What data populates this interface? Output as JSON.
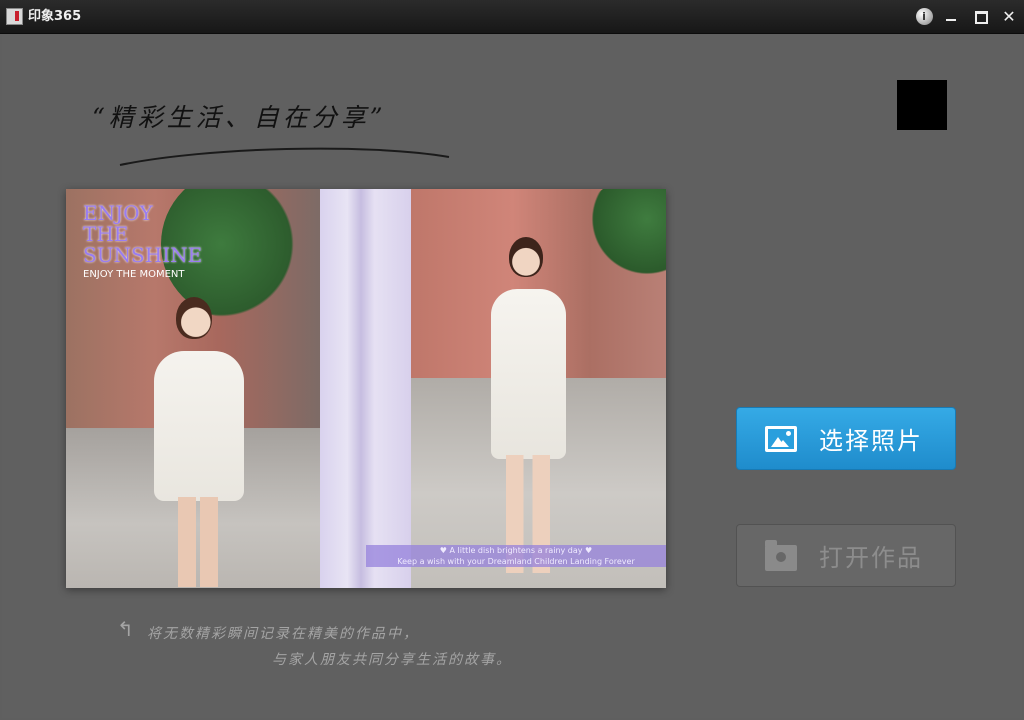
{
  "window": {
    "title": "印象365",
    "controls": {
      "info": "i",
      "minimize": "",
      "maximize": "",
      "close": "✕"
    }
  },
  "main": {
    "slogan": "“精彩生活、自在分享”",
    "preview": {
      "enjoy_lines": [
        "ENJOY",
        "THE",
        "SUNSHINE"
      ],
      "enjoy_sub": "ENJOY THE MOMENT",
      "banner_lines": [
        "♥ A little dish brightens a rainy day ♥",
        "Keep a wish with your Dreamland Children Landing Forever"
      ]
    },
    "buttons": {
      "select_photos": "选择照片",
      "open_work": "打开作品"
    },
    "hint_lines": [
      "将无数精彩瞬间记录在精美的作品中，",
      "与家人朋友共同分享生活的故事。"
    ],
    "hint_arrow": "↰"
  },
  "colors": {
    "background": "#606060",
    "titlebar": "#1c1c1c",
    "select_button": "#2a9edb",
    "open_button": "#676767"
  }
}
